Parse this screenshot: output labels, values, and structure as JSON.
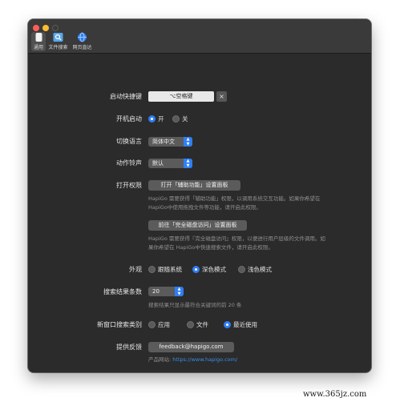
{
  "toolbar": {
    "tabs": [
      {
        "label": "通用",
        "icon": "general-doc-icon",
        "selected": true
      },
      {
        "label": "文件搜索",
        "icon": "file-search-icon",
        "selected": false
      },
      {
        "label": "网页直达",
        "icon": "globe-icon",
        "selected": false
      }
    ]
  },
  "settings": {
    "hotkey": {
      "label": "启动快捷键",
      "value": "⌥空格键",
      "clear": "×"
    },
    "launch_at_login": {
      "label": "开机启动",
      "options": [
        "开",
        "关"
      ],
      "selected": "开"
    },
    "language": {
      "label": "切换语言",
      "value": "简体中文"
    },
    "sound": {
      "label": "动作铃声",
      "value": "默认"
    },
    "permissions": {
      "label": "打开权限",
      "accessibility_button": "打开「辅助功能」设置面板",
      "accessibility_hint_1": "HapiGo 需要获得「辅助功能」权限，以调用系统交互功能。如果你希望在",
      "accessibility_hint_2": "HapiGo中使用拖拽文件等功能，请开启此权限。",
      "disk_button": "前往「完全磁盘访问」设置面板",
      "disk_hint_1": "HapiGo 需要获得『完全磁盘访问』权限，以便进行用户层级的文件调用。如",
      "disk_hint_2": "果你希望在 HapiGo中快速搜索文件，请开启此权限。"
    },
    "appearance": {
      "label": "外观",
      "options": [
        "跟随系统",
        "深色模式",
        "浅色模式"
      ],
      "selected": "深色模式"
    },
    "result_count": {
      "label": "搜索结果条数",
      "value": "20",
      "hint": "搜索结果只显示最符合关键词的前 20 条"
    },
    "new_window_category": {
      "label": "新窗口搜索类别",
      "options": [
        "应用",
        "文件",
        "最近使用"
      ],
      "selected": "最近使用"
    },
    "feedback": {
      "label": "提供反馈",
      "button": "feedback@hapigo.com",
      "site_label": "产品网站:",
      "site_url": "https://www.hapigo.com/"
    }
  },
  "watermark": "www.365jz.com",
  "colors": {
    "accent": "#2f7ef6",
    "window_bg": "#2b2b2b",
    "link": "#3b8eea"
  }
}
